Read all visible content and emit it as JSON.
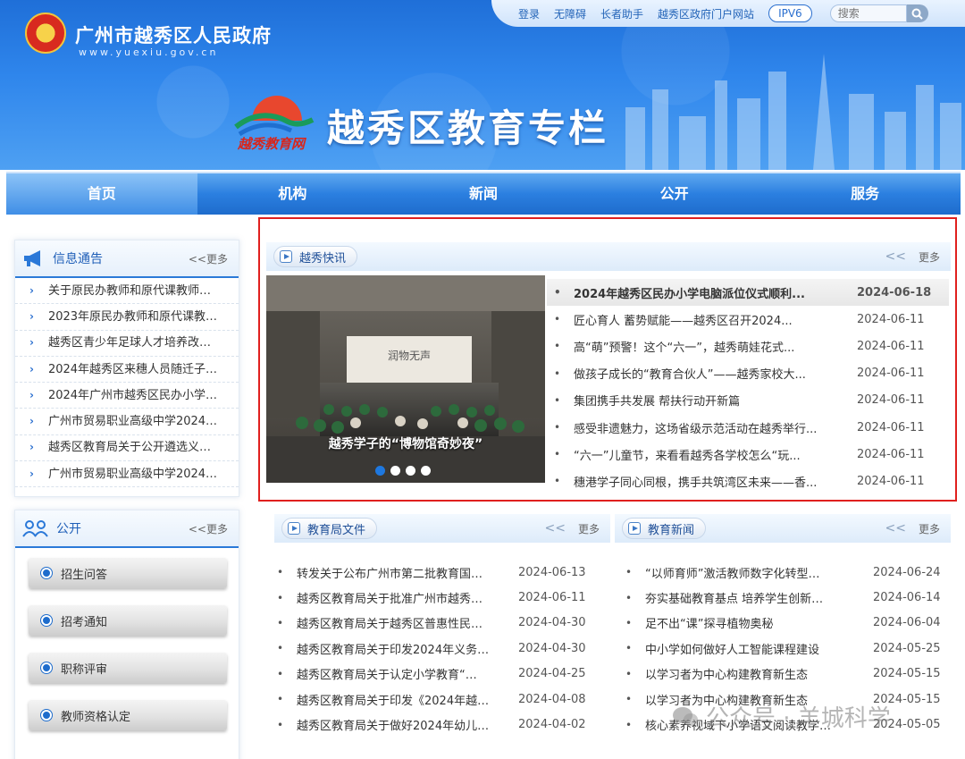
{
  "header": {
    "gov_title": "广州市越秀区人民政府",
    "gov_url": "www.yuexiu.gov.cn",
    "edu_logo_text": "越秀教育网",
    "edu_title": "越秀区教育专栏",
    "topbar": {
      "login": "登录",
      "accessibility": "无障碍",
      "elder": "长者助手",
      "portal": "越秀区政府门户网站",
      "ipv6": "IPV6",
      "search_placeholder": "搜索"
    }
  },
  "nav": [
    "首页",
    "机构",
    "新闻",
    "公开",
    "服务"
  ],
  "notice": {
    "title": "信息通告",
    "more": "<<更多",
    "items": [
      "关于原民办教师和原代课教师…",
      "2023年原民办教师和原代课教…",
      "越秀区青少年足球人才培养改…",
      "2024年越秀区来穗人员随迁子…",
      "2024年广州市越秀区民办小学…",
      "广州市贸易职业高级中学2024…",
      "越秀区教育局关于公开遴选义…",
      "广州市贸易职业高级中学2024…"
    ]
  },
  "open": {
    "title": "公开",
    "more": "<<更多",
    "buttons": [
      "招生问答",
      "招考通知",
      "职称评审",
      "教师资格认定"
    ]
  },
  "express": {
    "title": "越秀快讯",
    "chev": "<<",
    "more": "更多",
    "caption": "越秀学子的“博物馆奇妙夜”",
    "items": [
      {
        "title": "2024年越秀区民办小学电脑派位仪式顺利...",
        "date": "2024-06-18"
      },
      {
        "title": "匠心育人 蓄势赋能——越秀区召开2024...",
        "date": "2024-06-11"
      },
      {
        "title": "高“萌”预警！这个“六一”，越秀萌娃花式...",
        "date": "2024-06-11"
      },
      {
        "title": "做孩子成长的“教育合伙人”——越秀家校大...",
        "date": "2024-06-11"
      },
      {
        "title": "集团携手共发展 帮扶行动开新篇",
        "date": "2024-06-11"
      },
      {
        "title": "感受非遗魅力，这场省级示范活动在越秀举行...",
        "date": "2024-06-11"
      },
      {
        "title": "“六一”儿童节，来看看越秀各学校怎么“玩...",
        "date": "2024-06-11"
      },
      {
        "title": "穗港学子同心同根，携手共筑湾区未来——香...",
        "date": "2024-06-11"
      }
    ]
  },
  "docs": {
    "title": "教育局文件",
    "chev": "<<",
    "more": "更多",
    "items": [
      {
        "title": "转发关于公布广州市第二批教育国…",
        "date": "2024-06-13"
      },
      {
        "title": "越秀区教育局关于批准广州市越秀…",
        "date": "2024-06-11"
      },
      {
        "title": "越秀区教育局关于越秀区普惠性民…",
        "date": "2024-04-30"
      },
      {
        "title": "越秀区教育局关于印发2024年义务…",
        "date": "2024-04-30"
      },
      {
        "title": "越秀区教育局关于认定小学教育“…",
        "date": "2024-04-25"
      },
      {
        "title": "越秀区教育局关于印发《2024年越…",
        "date": "2024-04-08"
      },
      {
        "title": "越秀区教育局关于做好2024年幼儿…",
        "date": "2024-04-02"
      }
    ]
  },
  "edu_news": {
    "title": "教育新闻",
    "chev": "<<",
    "more": "更多",
    "items": [
      {
        "title": "“以师育师”激活教师数字化转型…",
        "date": "2024-06-24"
      },
      {
        "title": "夯实基础教育基点 培养学生创新…",
        "date": "2024-06-14"
      },
      {
        "title": "足不出“课”探寻植物奥秘",
        "date": "2024-06-04"
      },
      {
        "title": "中小学如何做好人工智能课程建设",
        "date": "2024-05-25"
      },
      {
        "title": "以学习者为中心构建教育新生态",
        "date": "2024-05-15"
      },
      {
        "title": "以学习者为中心构建教育新生态",
        "date": "2024-05-15"
      },
      {
        "title": "核心素养视域下小学语文阅读教学…",
        "date": "2024-05-05"
      }
    ]
  },
  "watermark": "公众号 · 羊城科学",
  "colors": {
    "primary": "#1e6ccc",
    "highlight_border": "#e0201e"
  }
}
